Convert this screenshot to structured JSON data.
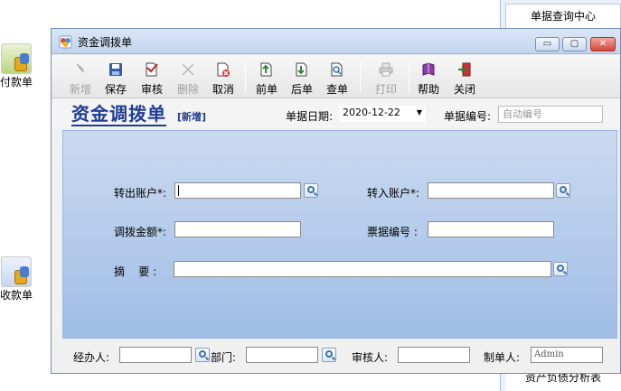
{
  "desktop": {
    "icons": [
      {
        "name": "payment",
        "label": "付款单"
      },
      {
        "name": "receipt",
        "label": "收款单"
      }
    ]
  },
  "right_panel": {
    "top_item": "单据查询中心",
    "bottom_item": "资产负债分析表"
  },
  "window": {
    "title": "资金调拨单",
    "controls": {
      "minimize": "▭",
      "restore": "▢",
      "close": "✕"
    }
  },
  "toolbar": {
    "new": "新增",
    "save": "保存",
    "audit": "审核",
    "delete": "删除",
    "cancel": "取消",
    "prev": "前单",
    "next": "后单",
    "query": "查单",
    "print": "打印",
    "help": "帮助",
    "close": "关闭"
  },
  "header": {
    "doc_title": "资金调拨单",
    "status": "[新增]",
    "date_label": "单据日期:",
    "date_value": "2020-12-22",
    "number_label": "单据编号:",
    "number_placeholder": "自动编号"
  },
  "form": {
    "out_account_label": "转出账户*:",
    "out_account_value": "",
    "in_account_label": "转入账户*:",
    "in_account_value": "",
    "amount_label": "调拨金额*:",
    "amount_value": "",
    "bill_no_label": "票据编号 :",
    "bill_no_value": "",
    "summary_label": "摘    要 :",
    "summary_value": ""
  },
  "footer": {
    "handler_label": "经办人:",
    "handler_value": "",
    "dept_label": "部门:",
    "dept_value": "",
    "auditor_label": "审核人:",
    "auditor_value": "",
    "creator_label": "制单人:",
    "creator_value": "Admin"
  },
  "colors": {
    "title_blue": "#1f3d96",
    "form_gradient_top": "#cbdaf0",
    "form_gradient_bottom": "#9fbde6",
    "close_button": "#d9463b"
  },
  "icons": {
    "new": "new-doc-icon",
    "save": "floppy-icon",
    "audit": "audit-icon",
    "delete": "delete-x-icon",
    "cancel": "cancel-icon",
    "prev": "prev-doc-icon",
    "next": "next-doc-icon",
    "query": "search-doc-icon",
    "print": "printer-icon",
    "help": "help-book-icon",
    "close": "exit-door-icon",
    "lookup": "magnifier-icon"
  }
}
